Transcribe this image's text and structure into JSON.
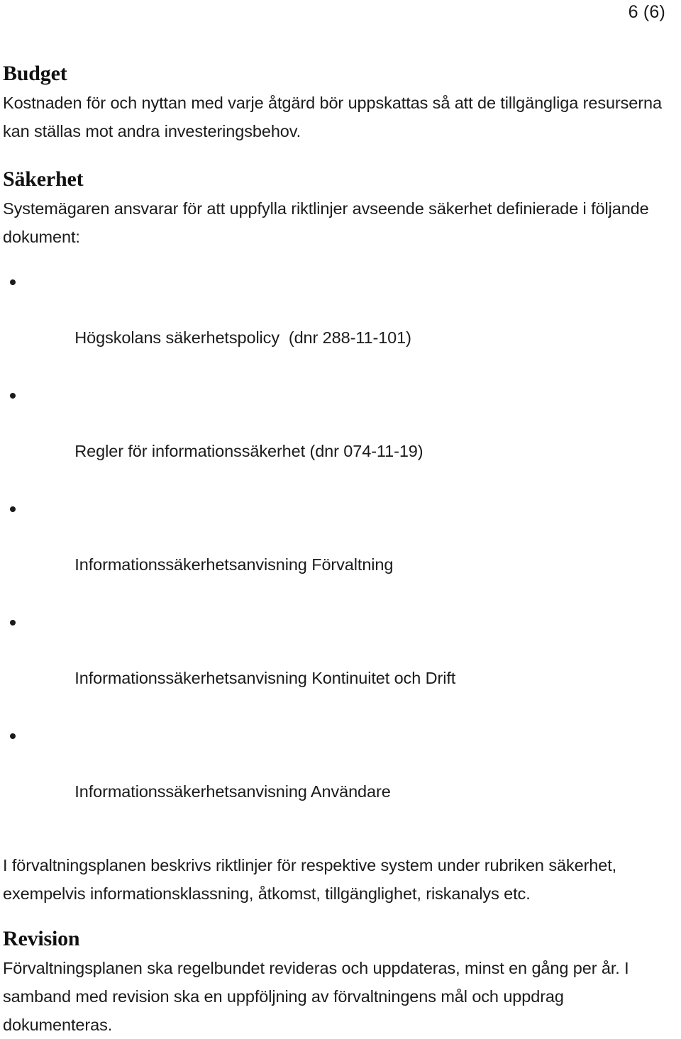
{
  "document": {
    "page_label": "6 (6)",
    "language": "sv"
  },
  "sections": [
    {
      "heading": "Budget",
      "paragraph": "Kostnaden för och nyttan med varje åtgärd bör uppskattas så att de tillgängliga resurserna kan ställas mot andra investeringsbehov."
    },
    {
      "heading": "Säkerhet",
      "paragraph": "Systemägaren ansvarar för att uppfylla riktlinjer avseende säkerhet definierade i följande dokument:",
      "bullets": [
        "Högskolans säkerhetspolicy  (dnr 288-11-101)",
        "Regler för informationssäkerhet (dnr 074-11-19)",
        "Informationssäkerhetsanvisning Förvaltning",
        "Informationssäkerhetsanvisning Kontinuitet och Drift",
        "Informationssäkerhetsanvisning Användare"
      ],
      "closing_paragraph": "I förvaltningsplanen beskrivs riktlinjer för respektive system under rubriken säkerhet, exempelvis informationsklassning, åtkomst, tillgänglighet, riskanalys etc."
    },
    {
      "heading": "Revision",
      "paragraph": "Förvaltningsplanen ska regelbundet revideras och uppdateras, minst en gång per år. I samband med revision ska en uppföljning av förvaltningens mål och uppdrag dokumenteras."
    }
  ],
  "colors": {
    "page_background": "#ffffff",
    "body_text": "#1b1b1b",
    "heading_text": "#111111"
  }
}
